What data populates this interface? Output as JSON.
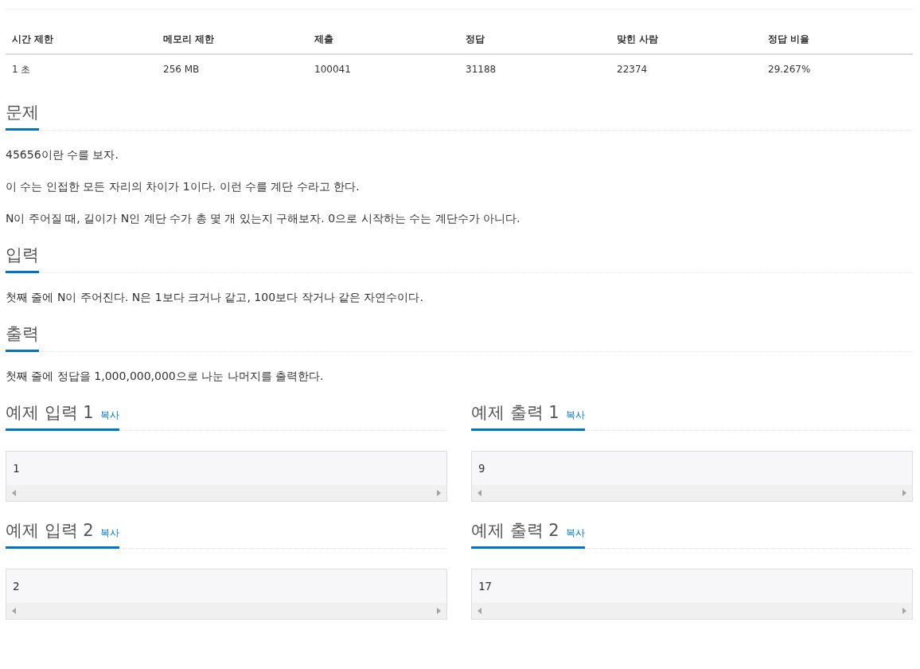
{
  "info_table": {
    "columns": [
      "시간 제한",
      "메모리 제한",
      "제출",
      "정답",
      "맞힌 사람",
      "정답 비율"
    ],
    "row": [
      "1 초",
      "256 MB",
      "100041",
      "31188",
      "22374",
      "29.267%"
    ]
  },
  "sections": [
    {
      "title": "문제",
      "paragraphs": [
        "45656이란 수를 보자.",
        "이 수는 인접한 모든 자리의 차이가 1이다. 이런 수를 계단 수라고 한다.",
        "N이 주어질 때, 길이가 N인 계단 수가 총 몇 개 있는지 구해보자. 0으로 시작하는 수는 계단수가 아니다."
      ]
    },
    {
      "title": "입력",
      "paragraphs": [
        "첫째 줄에 N이 주어진다. N은 1보다 크거나 같고, 100보다 작거나 같은 자연수이다."
      ]
    },
    {
      "title": "출력",
      "paragraphs": [
        "첫째 줄에 정답을 1,000,000,000으로 나눈 나머지를 출력한다."
      ]
    }
  ],
  "samples": [
    {
      "input_title": "예제 입력 1",
      "input_copy": "복사",
      "input": "1",
      "output_title": "예제 출력 1",
      "output_copy": "복사",
      "output": "9"
    },
    {
      "input_title": "예제 입력 2",
      "input_copy": "복사",
      "input": "2",
      "output_title": "예제 출력 2",
      "output_copy": "복사",
      "output": "17"
    }
  ]
}
